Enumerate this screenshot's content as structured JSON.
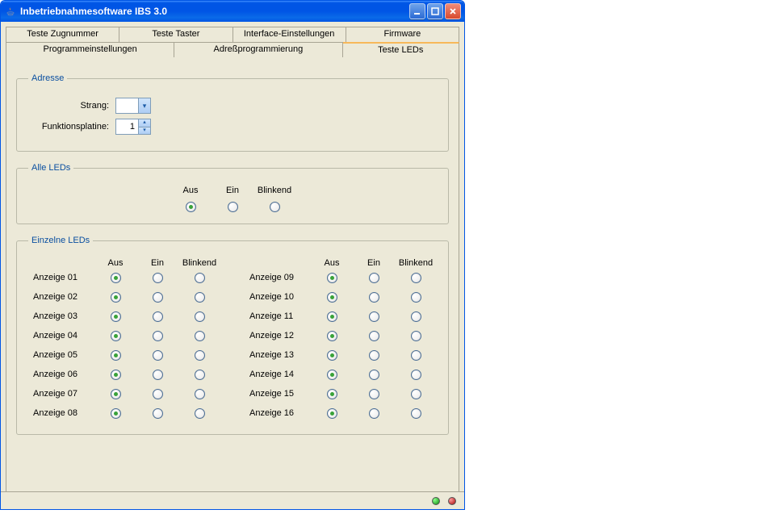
{
  "window": {
    "title": "Inbetriebnahmesoftware IBS 3.0"
  },
  "tabs_row1": {
    "t0": "Teste Zugnummer",
    "t1": "Teste Taster",
    "t2": "Interface-Einstellungen",
    "t3": "Firmware"
  },
  "tabs_row2": {
    "t0": "Programmeinstellungen",
    "t1": "Adreßprogrammierung",
    "t2": "Teste LEDs"
  },
  "groups": {
    "adresse": "Adresse",
    "alle": "Alle LEDs",
    "einzel": "Einzelne LEDs"
  },
  "adresse": {
    "strang_label": "Strang:",
    "funktionsplatine_label": "Funktionsplatine:",
    "strang_value": "",
    "funktionsplatine_value": "1"
  },
  "columns": {
    "aus": "Aus",
    "ein": "Ein",
    "blinkend": "Blinkend"
  },
  "anzeigen_left": {
    "a1": "Anzeige 01",
    "a2": "Anzeige 02",
    "a3": "Anzeige 03",
    "a4": "Anzeige 04",
    "a5": "Anzeige 05",
    "a6": "Anzeige 06",
    "a7": "Anzeige 07",
    "a8": "Anzeige 08"
  },
  "anzeigen_right": {
    "a9": "Anzeige 09",
    "a10": "Anzeige 10",
    "a11": "Anzeige 11",
    "a12": "Anzeige 12",
    "a13": "Anzeige 13",
    "a14": "Anzeige 14",
    "a15": "Anzeige 15",
    "a16": "Anzeige 16"
  }
}
